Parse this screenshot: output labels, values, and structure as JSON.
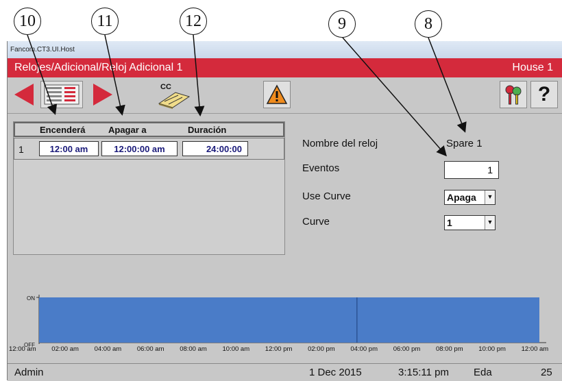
{
  "callouts": [
    "10",
    "11",
    "12",
    "9",
    "8"
  ],
  "window": {
    "title": "Fancom.CT3.UI.Host"
  },
  "header": {
    "path": "Relojes/Adicional/Reloj Adicional 1",
    "house": "House 1",
    "color": "#d42a3c"
  },
  "toolbar": {
    "items": [
      "back-arrow-icon",
      "clock-list-icon",
      "forward-arrow-icon",
      "curve-cc-icon",
      "warning-icon",
      "keys-icon",
      "help-icon"
    ],
    "cc_label": "CC",
    "help_label": "?"
  },
  "events_table": {
    "headers": [
      "Encenderá",
      "Apagar a",
      "Duración"
    ],
    "rows": [
      {
        "num": "1",
        "on": "12:00 am",
        "off": "12:00:00 am",
        "duration": "24:00:00"
      }
    ]
  },
  "settings": {
    "clock_name_label": "Nombre del reloj",
    "clock_name": "Spare 1",
    "events_label": "Eventos",
    "events_value": "1",
    "use_curve_label": "Use Curve",
    "use_curve_value": "Apaga",
    "curve_label": "Curve",
    "curve_value": "1"
  },
  "chart_data": {
    "type": "area",
    "y_categories": [
      "OFF",
      "ON"
    ],
    "x_ticks": [
      "12:00 am",
      "02:00 am",
      "04:00 am",
      "06:00 am",
      "08:00 am",
      "10:00 am",
      "12:00 pm",
      "02:00 pm",
      "04:00 pm",
      "06:00 pm",
      "08:00 pm",
      "10:00 pm",
      "12:00 am"
    ],
    "segments": [
      {
        "start_hour": 0,
        "end_hour": 24,
        "state": "ON"
      }
    ],
    "fill_color": "#4a7cc8"
  },
  "status": {
    "user": "Admin",
    "date": "1 Dec 2015",
    "time": "3:15:11 pm",
    "lang": "Eda",
    "number": "25"
  }
}
